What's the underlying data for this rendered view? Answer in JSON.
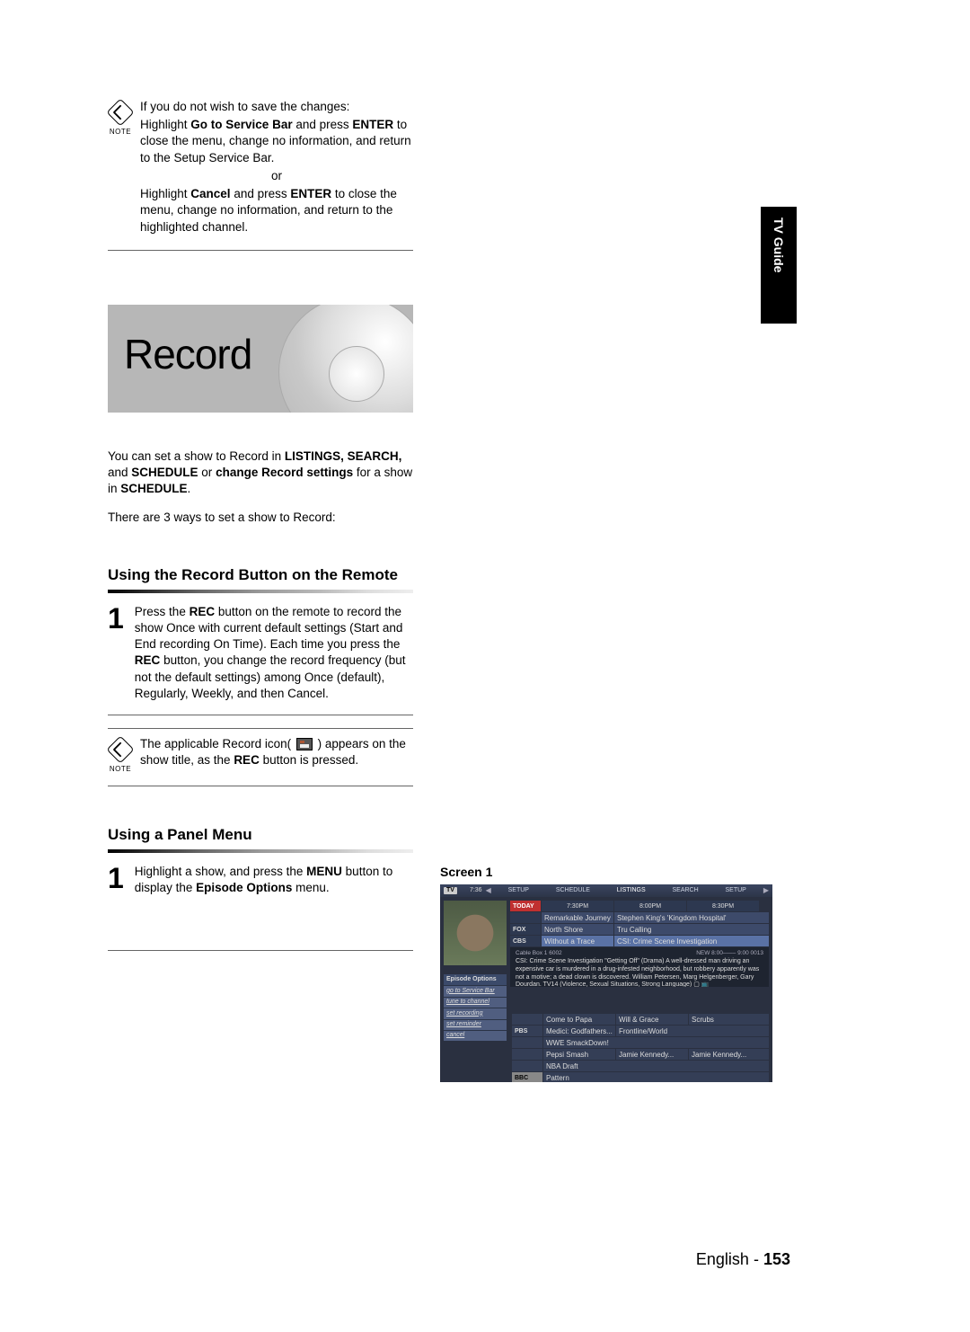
{
  "sideTab": "TV Guide",
  "note1": {
    "label": "NOTE",
    "line1": "If you do not wish to save the changes:",
    "line2a": "Highlight ",
    "line2b": "Go to Service Bar",
    "line2c": " and press ",
    "line2d": "ENTER",
    "line3": "to close the menu, change no information, and return to the Setup Service Bar.",
    "or": "or",
    "line4a": "Highlight ",
    "line4b": "Cancel",
    "line4c": " and press ",
    "line4d": "ENTER",
    "line4e": " to close the menu, change no information, and return to the highlighted channel."
  },
  "recordBanner": "Record",
  "intro": {
    "p1a": "You can set a show to Record in ",
    "p1b": "LISTINGS, SEARCH,",
    "p1c": "and ",
    "p1d": "SCHEDULE",
    "p1e": " or ",
    "p1f": "change Record settings",
    "p1g": " for a show in ",
    "p1h": "SCHEDULE",
    "p1i": ".",
    "p2": "There are 3 ways to set a show to Record:"
  },
  "section1": {
    "heading": "Using the Record Button on the Remote",
    "stepNum": "1",
    "t1": "Press the ",
    "t2": "REC",
    "t3": " button on the remote to record the show Once with current default settings (Start and End recording On Time). Each time you press the ",
    "t4": "REC",
    "t5": " button, you change the record frequency (but not the default settings) among Once (default), Regularly, Weekly, and then Cancel."
  },
  "note2": {
    "label": "NOTE",
    "t1": "The applicable Record icon( ",
    "t2": " ) appears on the show title, as the ",
    "t3": "REC",
    "t4": " button is pressed."
  },
  "section2": {
    "heading": "Using a Panel Menu",
    "stepNum": "1",
    "t1": "Highlight a show, and press the ",
    "t2": "MENU",
    "t3": " button to display the ",
    "t4": "Episode Options",
    "t5": " menu."
  },
  "screenLabel": "Screen 1",
  "tvguide": {
    "logo": "TV",
    "timeLabel": "7:36",
    "nav": [
      "SETUP",
      "SCHEDULE",
      "LISTINGS",
      "SEARCH",
      "SETUP"
    ],
    "headerRow": {
      "day": "TODAY",
      "t1": "7:30PM",
      "t2": "8:00PM",
      "t3": "8:30PM"
    },
    "channels": [
      "",
      "FOX",
      "CBS"
    ],
    "row1": [
      "Remarkable Journey",
      "Stephen King's 'Kingdom Hospital'"
    ],
    "row2": [
      "North Shore",
      "Tru Calling"
    ],
    "row3": [
      "Without a Trace",
      "CSI: Crime Scene Investigation"
    ],
    "descTop": "Cable Box 1 6002",
    "descBadge": "NEW  8:00–––– 9:00  0013",
    "desc": "CSI: Crime Scene Investigation \"Getting Off\" (Drama) A well-dressed man driving an expensive car is murdered in a drug-infested neighborhood, but robbery apparently was not a motive; a dead clown is discovered. William Petersen, Marg Helgenberger, Gary Dourdan. TV14 (Violence, Sexual Situations, Strong Language) ▢ 📺",
    "sidebarTitle": "Episode Options",
    "sidebarItems": [
      "go to Service Bar",
      "tune to channel",
      "set recording",
      "set reminder",
      "cancel"
    ],
    "lowerRows": [
      {
        "ch": "",
        "cells": [
          "Come to Papa",
          "Will & Grace",
          "Scrubs"
        ]
      },
      {
        "ch": "PBS",
        "cells": [
          "Medici: Godfathers...",
          "Frontline/World",
          ""
        ]
      },
      {
        "ch": "",
        "cells": [
          "WWE SmackDown!",
          "",
          ""
        ]
      },
      {
        "ch": "",
        "cells": [
          "Pepsi Smash",
          "Jamie Kennedy...",
          "Jamie Kennedy..."
        ]
      },
      {
        "ch": "",
        "cells": [
          "NBA Draft",
          "",
          ""
        ]
      },
      {
        "ch": "BBC",
        "cells": [
          "Pattern",
          "",
          ""
        ]
      }
    ]
  },
  "footer": {
    "language": "English - ",
    "pageNumber": "153"
  }
}
